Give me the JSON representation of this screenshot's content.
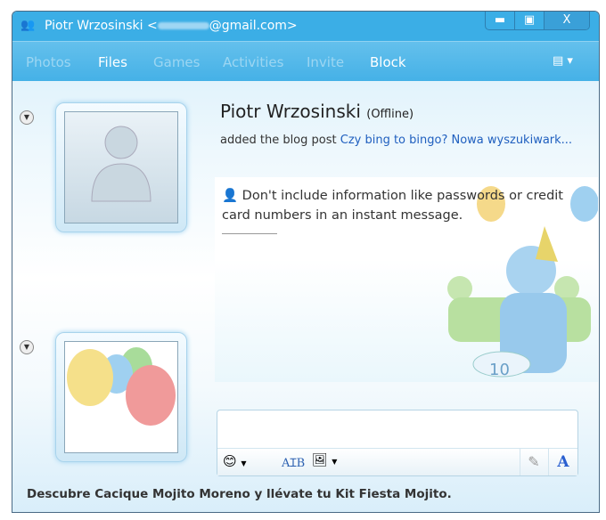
{
  "title": {
    "name": "Piotr Wrzosinski <",
    "email": "@gmail.com>"
  },
  "window_controls": {
    "minimize": "▬",
    "maximize": "▣",
    "close": "X"
  },
  "nav": [
    "Photos",
    "Files",
    "Games",
    "Activities",
    "Invite",
    "Block"
  ],
  "contact": {
    "name": "Piotr Wrzosinski",
    "status": "(Offline)",
    "activity": "added the blog post",
    "blog_link": "Czy bing to bingo? Nowa wyszukiwark..."
  },
  "chat": {
    "warning": "Don't include information like passwords or credit card numbers in an instant message.",
    "cake_number": "10"
  },
  "ad": "Descubre Cacique Mojito Moreno y llévate tu Kit Fiesta Mojito."
}
